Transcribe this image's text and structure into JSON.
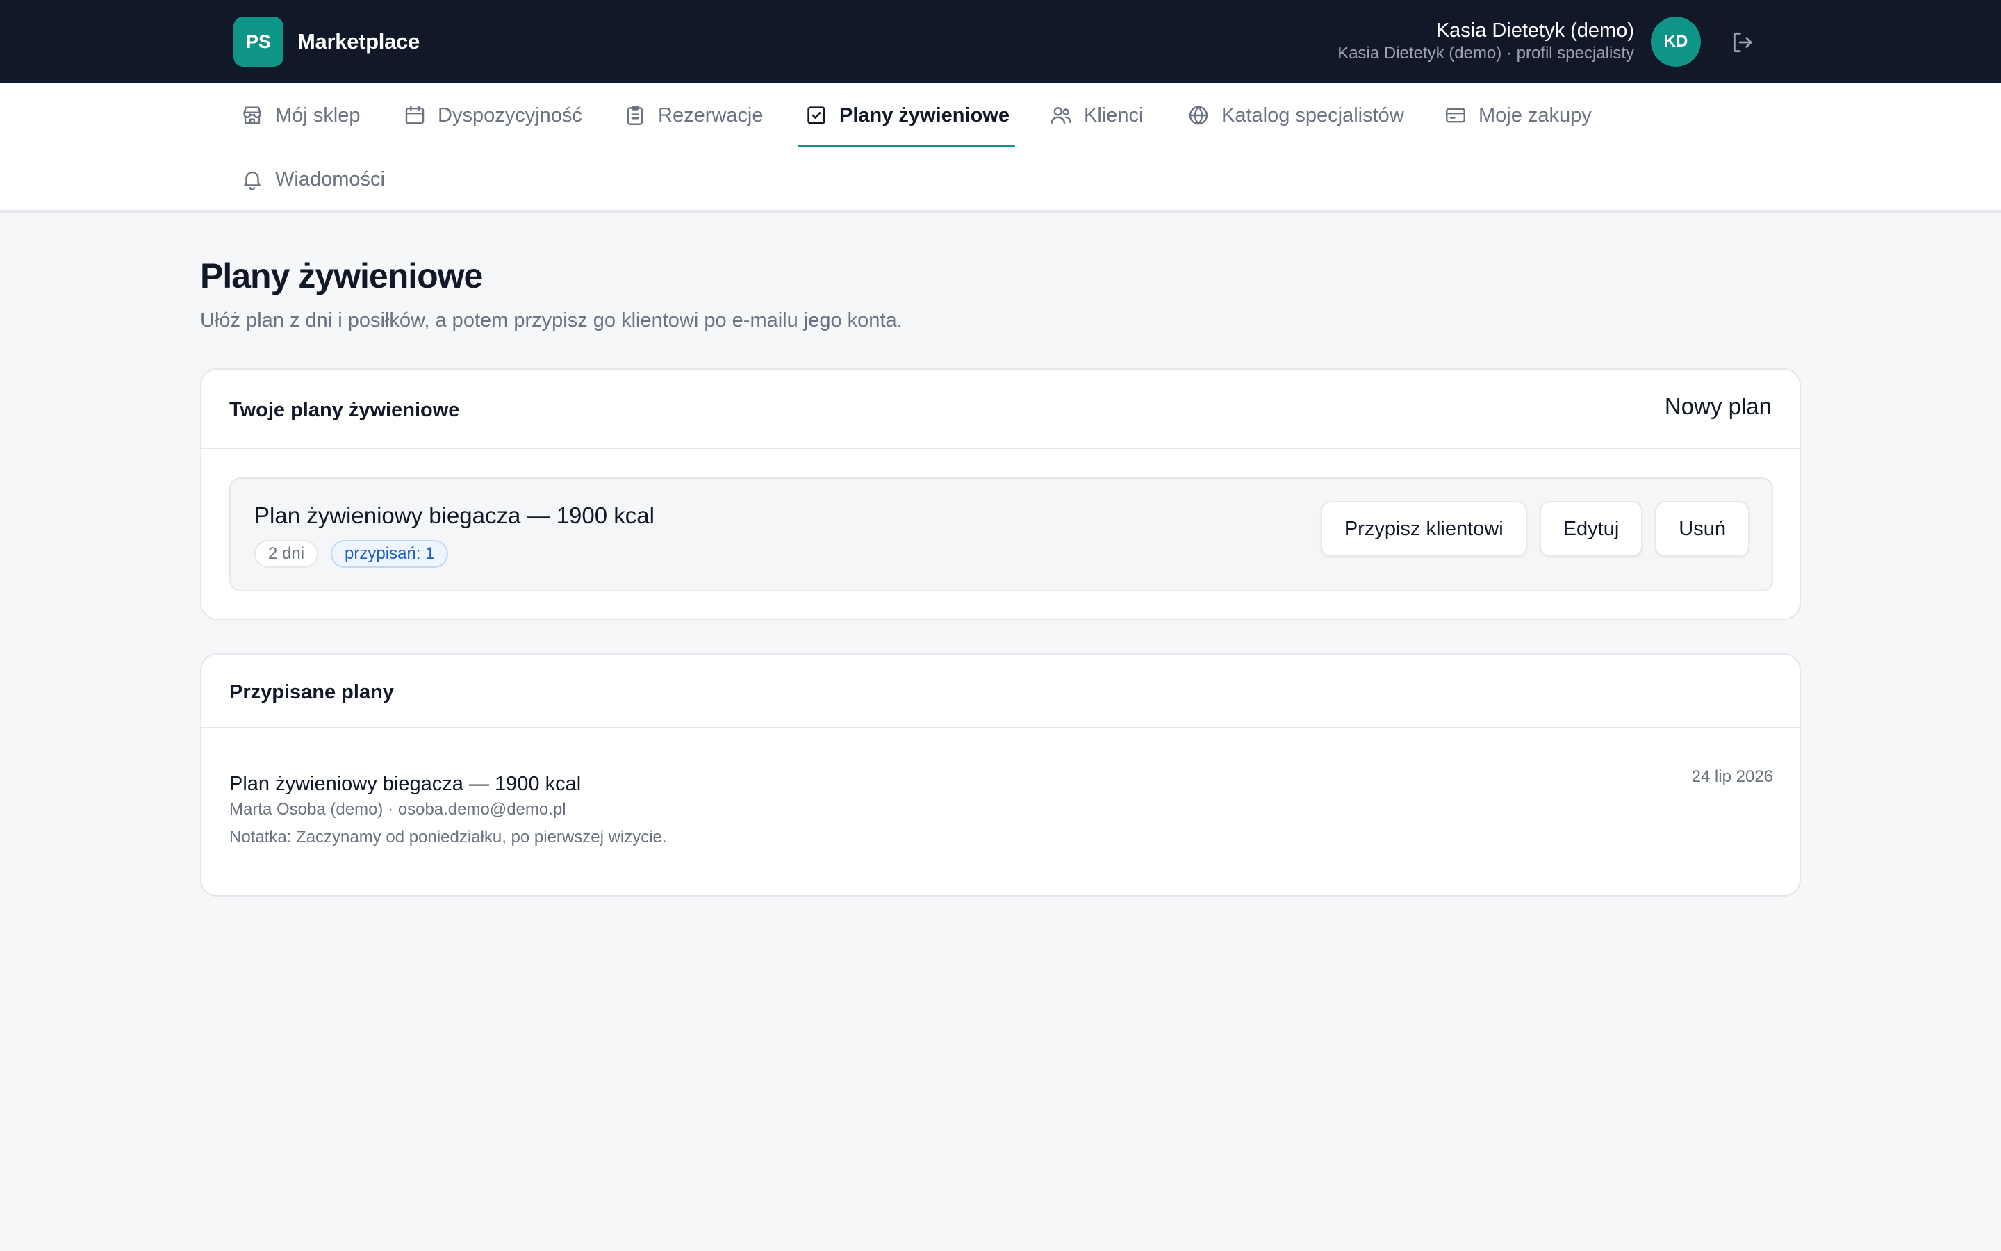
{
  "header": {
    "logo_text": "PS",
    "brand": "Marketplace",
    "user_name": "Kasia Dietetyk (demo)",
    "user_subtitle": "Kasia Dietetyk (demo) · profil specjalisty",
    "avatar_initials": "KD",
    "logout_icon": "logout-icon"
  },
  "nav": {
    "items": [
      {
        "label": "Mój sklep",
        "icon": "store-icon"
      },
      {
        "label": "Dyspozycyjność",
        "icon": "calendar-icon"
      },
      {
        "label": "Rezerwacje",
        "icon": "clipboard-icon"
      },
      {
        "label": "Plany żywieniowe",
        "icon": "checkbox-icon",
        "active": true
      },
      {
        "label": "Klienci",
        "icon": "users-icon"
      },
      {
        "label": "Katalog specjalistów",
        "icon": "globe-icon"
      },
      {
        "label": "Moje zakupy",
        "icon": "credit-card-icon"
      },
      {
        "label": "Wiadomości",
        "icon": "bell-icon"
      }
    ]
  },
  "page": {
    "title": "Plany żywieniowe",
    "subtitle": "Ułóż plan z dni i posiłków, a potem przypisz go klientowi po e-mailu jego konta."
  },
  "plans_card": {
    "title": "Twoje plany żywieniowe",
    "new_plan_label": "Nowy plan",
    "plans": [
      {
        "name": "Plan żywieniowy biegacza — 1900 kcal",
        "days_badge": "2 dni",
        "assigned_badge": "przypisań: 1",
        "actions": {
          "assign": "Przypisz klientowi",
          "edit": "Edytuj",
          "delete": "Usuń"
        }
      }
    ]
  },
  "assigned_card": {
    "title": "Przypisane plany",
    "items": [
      {
        "plan_name": "Plan żywieniowy biegacza — 1900 kcal",
        "client": "Marta Osoba (demo) · osoba.demo@demo.pl",
        "note": "Notatka: Zaczynamy od poniedziałku, po pierwszej wizycie.",
        "date": "24 lip 2026"
      }
    ]
  },
  "colors": {
    "topbar": "#111827",
    "accent": "#0f9488",
    "page_bg": "#f6f7f9"
  }
}
